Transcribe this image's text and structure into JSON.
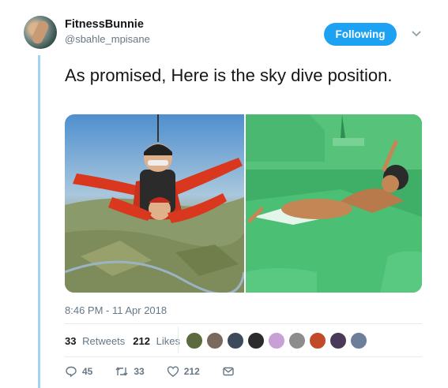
{
  "author": {
    "name": "FitnessBunnie",
    "handle": "@sbahle_mpisane",
    "follow_label": "Following"
  },
  "tweet": {
    "text": "As promised, Here is the sky dive position.",
    "timestamp": "8:46 PM - 11 Apr 2018"
  },
  "stats": {
    "retweets_count": "33",
    "retweets_label": "Retweets",
    "likes_count": "212",
    "likes_label": "Likes"
  },
  "likers": [
    {
      "color": "#5b6b3e"
    },
    {
      "color": "#7a6a5c"
    },
    {
      "color": "#3e4a5a"
    },
    {
      "color": "#2b2b2b"
    },
    {
      "color": "#c9a0d6"
    },
    {
      "color": "#8d8d8d"
    },
    {
      "color": "#c24a2a"
    },
    {
      "color": "#4a3a5a"
    },
    {
      "color": "#6b7f9a"
    }
  ],
  "actions": {
    "reply_count": "45",
    "retweet_count": "33",
    "like_count": "212"
  },
  "colors": {
    "accent": "#1da1f2",
    "muted": "#657786",
    "thread": "#9fd5f2"
  }
}
